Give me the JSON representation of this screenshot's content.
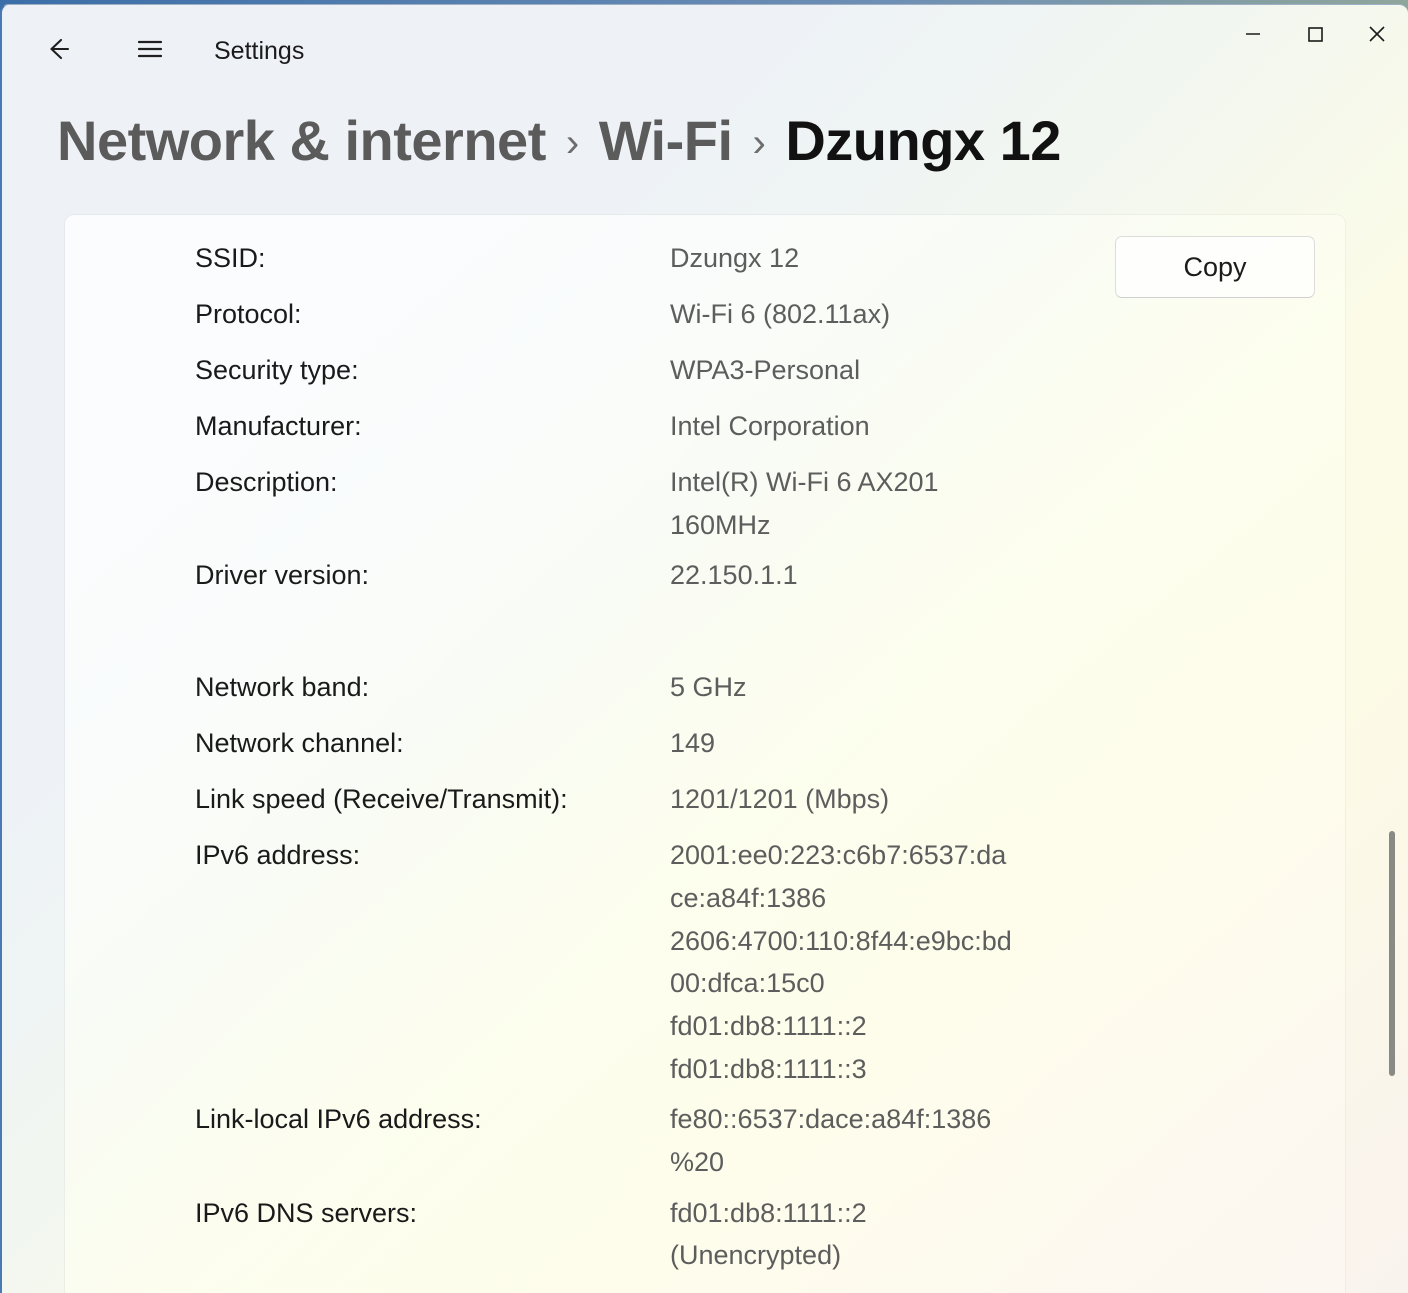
{
  "window": {
    "app_title": "Settings",
    "back_icon": "arrow-left-icon",
    "menu_icon": "hamburger-menu-icon",
    "minimize_label": "Minimize",
    "maximize_label": "Maximize",
    "close_label": "Close"
  },
  "breadcrumb": {
    "items": [
      {
        "label": "Network & internet",
        "current": false
      },
      {
        "label": "Wi-Fi",
        "current": false
      },
      {
        "label": "Dzungx 12",
        "current": true
      }
    ],
    "separator": "›"
  },
  "actions": {
    "copy_label": "Copy"
  },
  "properties": [
    {
      "label": "SSID:",
      "value": "Dzungx 12"
    },
    {
      "label": "Protocol:",
      "value": "Wi-Fi 6 (802.11ax)"
    },
    {
      "label": "Security type:",
      "value": "WPA3-Personal"
    },
    {
      "label": "Manufacturer:",
      "value": "Intel Corporation"
    },
    {
      "label": "Description:",
      "value": "Intel(R) Wi-Fi 6 AX201 160MHz"
    },
    {
      "label": "Driver version:",
      "value": "22.150.1.1"
    },
    {
      "label": "Network band:",
      "value": "5 GHz"
    },
    {
      "label": "Network channel:",
      "value": "149"
    },
    {
      "label": "Link speed (Receive/Transmit):",
      "value": "1201/1201 (Mbps)"
    },
    {
      "label": "IPv6 address:",
      "value": "2001:ee0:223:c6b7:6537:dace:a84f:1386\n2606:4700:110:8f44:e9bc:bd00:dfca:15c0\nfd01:db8:1111::2\nfd01:db8:1111::3"
    },
    {
      "label": "Link-local IPv6 address:",
      "value": "fe80::6537:dace:a84f:1386%20"
    },
    {
      "label": "IPv6 DNS servers:",
      "value": "fd01:db8:1111::2 (Unencrypted)"
    }
  ],
  "colors": {
    "label_text": "#1a1a1a",
    "value_text": "#5d5d5d",
    "breadcrumb_inactive": "#5b5b5b",
    "breadcrumb_active": "#111111",
    "window_accent_border": "#4a7ab5",
    "scrollbar_thumb": "#8a8a84"
  }
}
